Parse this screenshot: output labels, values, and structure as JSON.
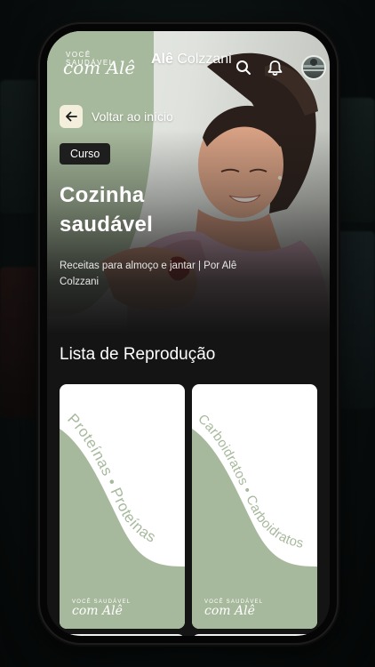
{
  "header": {
    "logo_top": "VOCÊ SAUDÁVEL",
    "logo_script": "com Alê",
    "brand_first": "Alê",
    "brand_last": "Colzzani",
    "icons": [
      "search-icon",
      "bell-icon",
      "avatar"
    ]
  },
  "back": {
    "label": "Voltar ao início",
    "icon": "arrow-left-icon"
  },
  "course": {
    "tag": "Curso",
    "title": "Cozinha saudável",
    "subtitle": "Receitas para almoço e jantar | Por Alê Colzzani"
  },
  "playlist": {
    "title": "Lista de Reprodução",
    "cards": [
      {
        "curve_text": "Proteínas • Proteínas",
        "logo_top": "VOCÊ SAUDÁVEL",
        "logo_script": "com Alê"
      },
      {
        "curve_text": "Carboidratos • Carboidratos",
        "logo_top": "VOCÊ SAUDÁVEL",
        "logo_script": "com Alê"
      }
    ]
  },
  "colors": {
    "sage": "#a7b99c",
    "dark": "#141414",
    "back_button": "#f3efdc"
  }
}
